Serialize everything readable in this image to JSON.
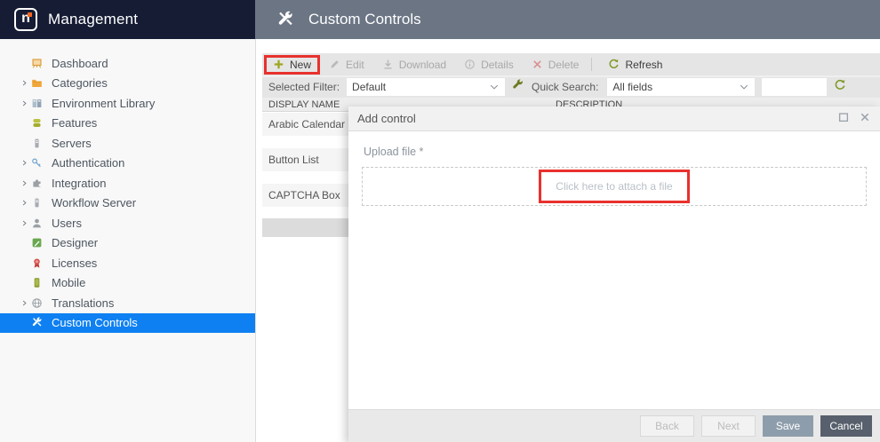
{
  "app_header": {
    "logo_letter": "n",
    "title": "Management"
  },
  "page_header": {
    "icon": "tools",
    "title": "Custom Controls"
  },
  "sidebar": {
    "items": [
      {
        "label": "Dashboard",
        "icon": "easel",
        "expandable": false,
        "selected": false
      },
      {
        "label": "Categories",
        "icon": "folder",
        "expandable": true,
        "selected": false
      },
      {
        "label": "Environment Library",
        "icon": "library",
        "expandable": true,
        "selected": false
      },
      {
        "label": "Features",
        "icon": "features",
        "expandable": false,
        "selected": false
      },
      {
        "label": "Servers",
        "icon": "server",
        "expandable": false,
        "selected": false
      },
      {
        "label": "Authentication",
        "icon": "key",
        "expandable": true,
        "selected": false
      },
      {
        "label": "Integration",
        "icon": "puzzle",
        "expandable": true,
        "selected": false
      },
      {
        "label": "Workflow Server",
        "icon": "server",
        "expandable": true,
        "selected": false
      },
      {
        "label": "Users",
        "icon": "user",
        "expandable": true,
        "selected": false
      },
      {
        "label": "Designer",
        "icon": "designer",
        "expandable": false,
        "selected": false
      },
      {
        "label": "Licenses",
        "icon": "license",
        "expandable": false,
        "selected": false
      },
      {
        "label": "Mobile",
        "icon": "mobile",
        "expandable": false,
        "selected": false
      },
      {
        "label": "Translations",
        "icon": "globe",
        "expandable": true,
        "selected": false
      },
      {
        "label": "Custom Controls",
        "icon": "tools",
        "expandable": false,
        "selected": true
      }
    ]
  },
  "toolbar": {
    "buttons": [
      {
        "label": "New",
        "icon": "plus",
        "enabled": true,
        "annotated": true,
        "separator_before": false
      },
      {
        "label": "Edit",
        "icon": "pencil",
        "enabled": false,
        "annotated": false,
        "separator_before": false
      },
      {
        "label": "Download",
        "icon": "download",
        "enabled": false,
        "annotated": false,
        "separator_before": false
      },
      {
        "label": "Details",
        "icon": "info",
        "enabled": false,
        "annotated": false,
        "separator_before": false
      },
      {
        "label": "Delete",
        "icon": "xmark",
        "enabled": false,
        "annotated": false,
        "separator_before": false
      },
      {
        "label": "Refresh",
        "icon": "refresh",
        "enabled": true,
        "annotated": false,
        "separator_before": true
      }
    ]
  },
  "filter_bar": {
    "selected_filter_label": "Selected Filter:",
    "selected_filter_value": "Default",
    "quick_search_label": "Quick Search:",
    "quick_search_value": "All fields",
    "search_input_value": ""
  },
  "table": {
    "columns": [
      "DISPLAY NAME",
      "DESCRIPTION"
    ],
    "rows": [
      {
        "display_name": "Arabic Calendar"
      },
      {
        "display_name": "Button List"
      },
      {
        "display_name": "CAPTCHA Box"
      }
    ]
  },
  "modal": {
    "title": "Add control",
    "upload_label": "Upload file *",
    "attach_text": "Click here to attach a file",
    "buttons": [
      {
        "label": "Back",
        "style": "disabled"
      },
      {
        "label": "Next",
        "style": "disabled"
      },
      {
        "label": "Save",
        "style": "save"
      },
      {
        "label": "Cancel",
        "style": "cancel"
      }
    ]
  },
  "annotations": {
    "highlight_color": "#e8312d",
    "targets": [
      "new-button",
      "attach-file-area"
    ]
  },
  "colors": {
    "app_header_bg": "#151c34",
    "page_header_bg": "#6b7584",
    "selected_item_bg": "#0e80f2",
    "toolbar_bg": "#e5e5e5",
    "accent_olive": "#9ea61f",
    "logo_dot": "#f26522"
  }
}
